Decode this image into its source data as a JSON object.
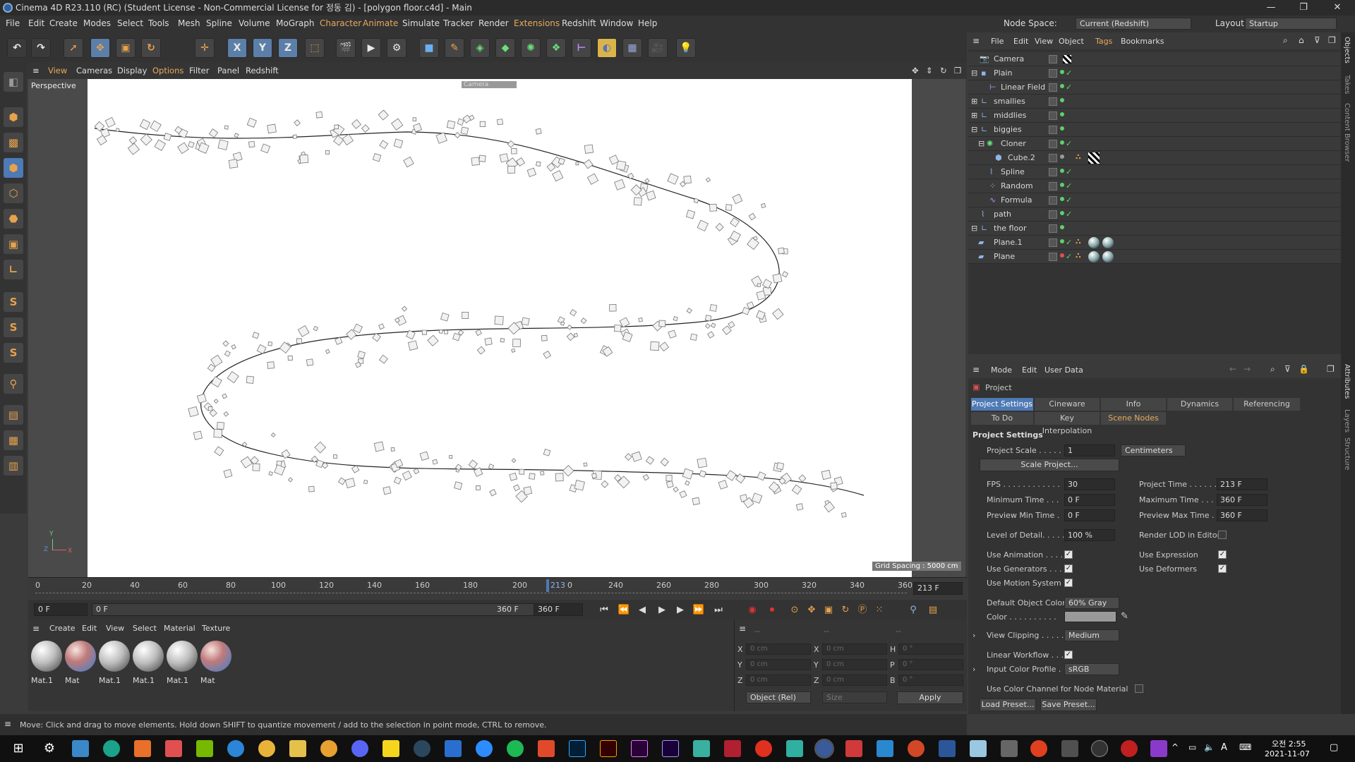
{
  "window": {
    "title": "Cinema 4D R23.110 (RC) (Student License - Non-Commercial License for 정동 김) - [polygon floor.c4d] - Main",
    "minimize": "—",
    "maximize": "❐",
    "close": "✕"
  },
  "menubar": {
    "items": [
      "File",
      "Edit",
      "Create",
      "Modes",
      "Select",
      "Tools",
      "Mesh",
      "Spline",
      "Volume",
      "MoGraph",
      "Character",
      "Animate",
      "Simulate",
      "Tracker",
      "Render",
      "Extensions",
      "Redshift",
      "Window",
      "Help"
    ],
    "node_space_label": "Node Space:",
    "node_space_value": "Current (Redshift)",
    "layout_label": "Layout:",
    "layout_value": "Startup"
  },
  "viewport": {
    "menu": [
      "View",
      "Cameras",
      "Display",
      "Options",
      "Filter",
      "Panel",
      "Redshift"
    ],
    "view_name": "Perspective",
    "camera_tag": "Camera",
    "grid_spacing": "Grid Spacing : 5000 cm",
    "axis_y": "Y",
    "axis_z": "Z",
    "axis_x": "X"
  },
  "timeline": {
    "ticks": [
      "0",
      "20",
      "40",
      "60",
      "80",
      "100",
      "120",
      "140",
      "160",
      "180",
      "200",
      "",
      "240",
      "260",
      "280",
      "300",
      "320",
      "340",
      "360"
    ],
    "current_marker": "213",
    "current_suffix": "0",
    "end_field": "213 F"
  },
  "transport": {
    "start": "0 F",
    "range_start": "0 F",
    "range_end": "360 F",
    "end": "360 F"
  },
  "material_manager": {
    "menu": [
      "Create",
      "Edit",
      "View",
      "Select",
      "Material",
      "Texture"
    ],
    "materials": [
      {
        "name": "Mat.1",
        "type": "white"
      },
      {
        "name": "Mat",
        "type": "red"
      },
      {
        "name": "Mat.1",
        "type": "white"
      },
      {
        "name": "Mat.1",
        "type": "white"
      },
      {
        "name": "Mat.1",
        "type": "white"
      },
      {
        "name": "Mat",
        "type": "red"
      }
    ]
  },
  "coordinates": {
    "header": [
      "--",
      "--",
      "--"
    ],
    "rows": [
      {
        "a": "X",
        "av": "0 cm",
        "b": "X",
        "bv": "0 cm",
        "c": "H",
        "cv": "0 °"
      },
      {
        "a": "Y",
        "av": "0 cm",
        "b": "Y",
        "bv": "0 cm",
        "c": "P",
        "cv": "0 °"
      },
      {
        "a": "Z",
        "av": "0 cm",
        "b": "Z",
        "bv": "0 cm",
        "c": "B",
        "cv": "0 °"
      }
    ],
    "mode": "Object (Rel)",
    "size": "Size",
    "apply": "Apply"
  },
  "status": "Move: Click and drag to move elements. Hold down SHIFT to quantize movement / add to the selection in point mode, CTRL to remove.",
  "object_manager": {
    "menu": [
      "File",
      "Edit",
      "View",
      "Object",
      "Tags",
      "Bookmarks"
    ],
    "objects": [
      {
        "name": "Camera",
        "indent": 0
      },
      {
        "name": "Plain",
        "indent": 0
      },
      {
        "name": "Linear Field",
        "indent": 1
      },
      {
        "name": "smallies",
        "indent": 0
      },
      {
        "name": "middlies",
        "indent": 0
      },
      {
        "name": "biggies",
        "indent": 0
      },
      {
        "name": "Cloner",
        "indent": 1
      },
      {
        "name": "Cube.2",
        "indent": 2
      },
      {
        "name": "Spline",
        "indent": 1
      },
      {
        "name": "Random",
        "indent": 1
      },
      {
        "name": "Formula",
        "indent": 1
      },
      {
        "name": "path",
        "indent": 0
      },
      {
        "name": "the floor",
        "indent": 0
      },
      {
        "name": "Plane.1",
        "indent": 1
      },
      {
        "name": "Plane",
        "indent": 1
      }
    ]
  },
  "attributes": {
    "menu": [
      "Mode",
      "Edit",
      "User Data"
    ],
    "object": "Project",
    "tabs_row1": [
      "Project Settings",
      "Cineware",
      "Info",
      "Dynamics",
      "Referencing"
    ],
    "tabs_row2": [
      "To Do",
      "Key Interpolation",
      "Scene Nodes"
    ],
    "section": "Project Settings",
    "project_scale_label": "Project Scale . . . . .",
    "project_scale": "1",
    "scale_unit": "Centimeters",
    "scale_project_btn": "Scale Project...",
    "fps_label": "FPS . . . . . . . . . . . .",
    "fps": "30",
    "project_time_label": "Project Time . . . . . .",
    "project_time": "213 F",
    "min_time_label": "Minimum Time . . .",
    "min_time": "0 F",
    "max_time_label": "Maximum Time . . .",
    "max_time": "360 F",
    "prev_min_label": "Preview Min Time .",
    "prev_min": "0 F",
    "prev_max_label": "Preview Max Time . .",
    "prev_max": "360 F",
    "lod_label": "Level of Detail. . . . .",
    "lod": "100 %",
    "render_lod_label": "Render LOD in Editor",
    "use_animation": "Use Animation . . . .",
    "use_expression": "Use Expression",
    "use_generators": "Use Generators . . .",
    "use_deformers": "Use Deformers",
    "use_motion": "Use Motion System",
    "default_color_label": "Default Object Color",
    "default_color": "60% Gray",
    "color_label": "Color . . . . . . . . . .",
    "view_clipping_label": "View Clipping . . . . .",
    "view_clipping": "Medium",
    "linear_workflow": "Linear Workflow . . .",
    "input_profile_label": "Input Color Profile . .",
    "input_profile": "sRGB",
    "color_channel": "Use Color Channel for Node Material",
    "load_preset": "Load Preset...",
    "save_preset": "Save Preset..."
  },
  "right_strip": [
    "Objects",
    "Takes",
    "Content Browser",
    "Attributes",
    "Layers",
    "Structure"
  ],
  "taskbar": {
    "time": "오전 2:55",
    "date": "2021-11-07"
  },
  "colors": {
    "accent_blue": "#4e7ab5",
    "accent_orange": "#e8a95b",
    "check_green": "#5fcf6a"
  }
}
